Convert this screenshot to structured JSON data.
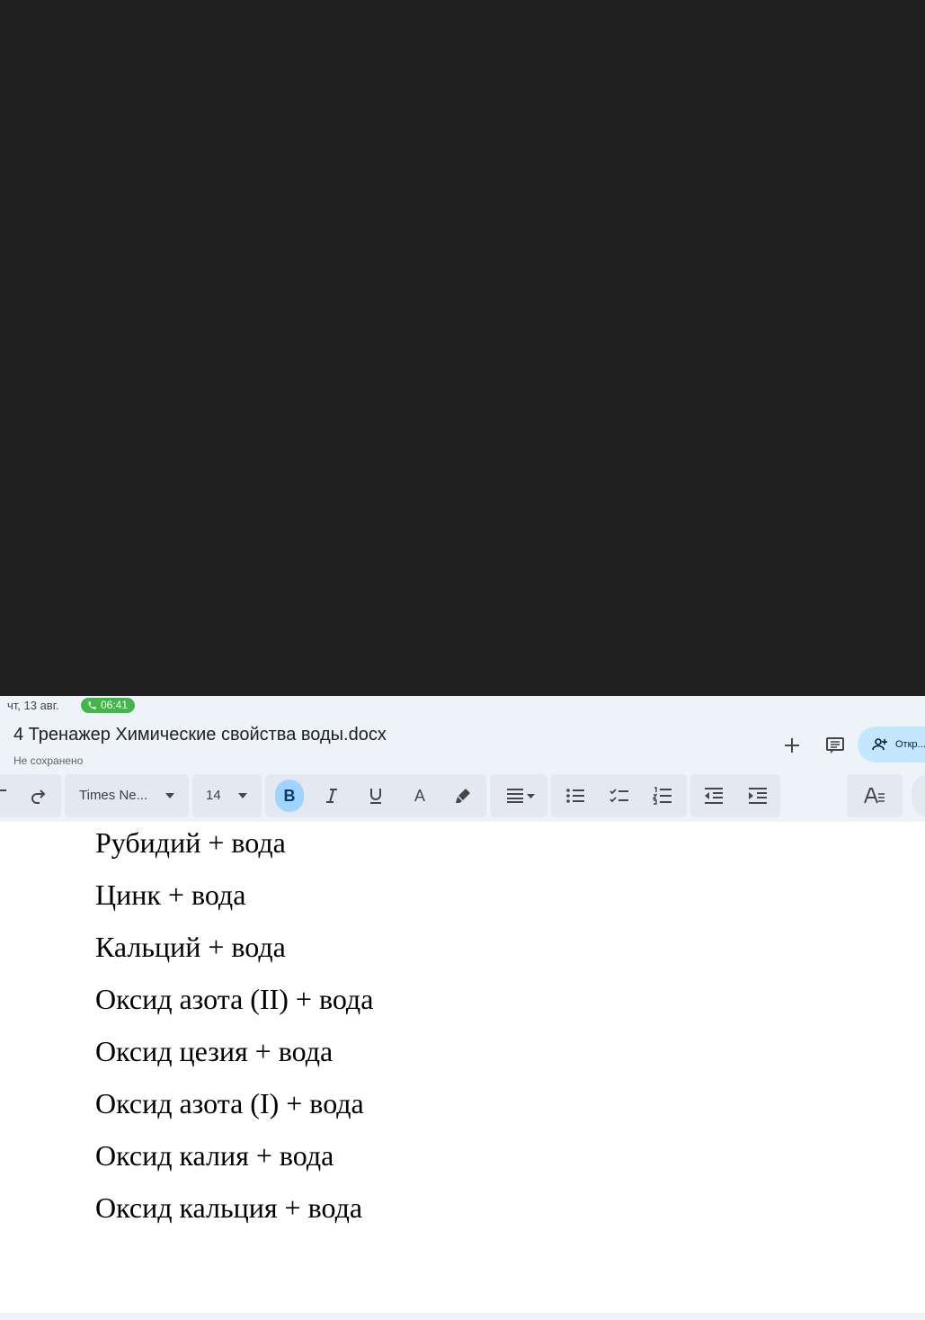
{
  "status_bar": {
    "date": "чт, 13 авг.",
    "call_time": "06:41"
  },
  "header": {
    "title": "4 Тренажер Химические свойства воды.docx",
    "save_status": "Не сохранено",
    "share_label": "Откр..."
  },
  "toolbar": {
    "font_name": "Times Ne...",
    "font_size": "14",
    "bold_label": "B",
    "text_color_label": "A"
  },
  "document": {
    "lines": [
      "Рубидий + вода",
      "Цинк + вода",
      "Кальций + вода",
      "Оксид азота (II) + вода",
      "Оксид цезия + вода",
      "Оксид азота (I) + вода",
      "Оксид калия + вода",
      "Оксид кальция + вода"
    ]
  },
  "colors": {
    "accent": "#c2e7ff",
    "call_badge": "#43b649",
    "bold_active": "#9fd4ff"
  }
}
